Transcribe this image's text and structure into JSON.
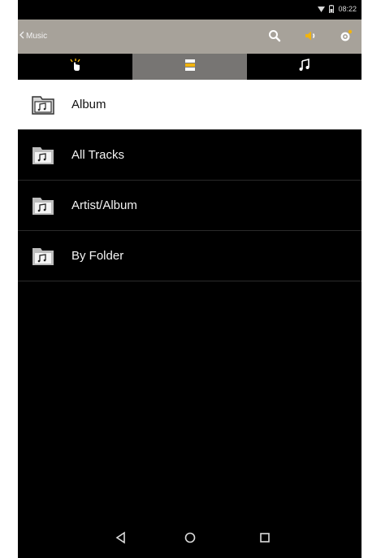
{
  "status_bar": {
    "time": "08:22"
  },
  "action_bar": {
    "back_label": "Music",
    "icons": [
      "search-icon",
      "volume-icon",
      "settings-icon"
    ]
  },
  "tabs": [
    {
      "icon": "tap-icon",
      "active": false
    },
    {
      "icon": "list-icon",
      "active": true
    },
    {
      "icon": "music-note-icon",
      "active": false
    }
  ],
  "list": {
    "items": [
      {
        "label": "Album",
        "selected": true
      },
      {
        "label": "All Tracks",
        "selected": false
      },
      {
        "label": "Artist/Album",
        "selected": false
      },
      {
        "label": "By Folder",
        "selected": false
      }
    ]
  },
  "nav_bar": {
    "icons": [
      "back-icon",
      "home-icon",
      "recents-icon"
    ]
  },
  "colors": {
    "action_bar": "#a7a29a",
    "active_tab": "#777573",
    "accent": "#f2b40e",
    "background": "#000000",
    "selected_row": "#ffffff"
  }
}
